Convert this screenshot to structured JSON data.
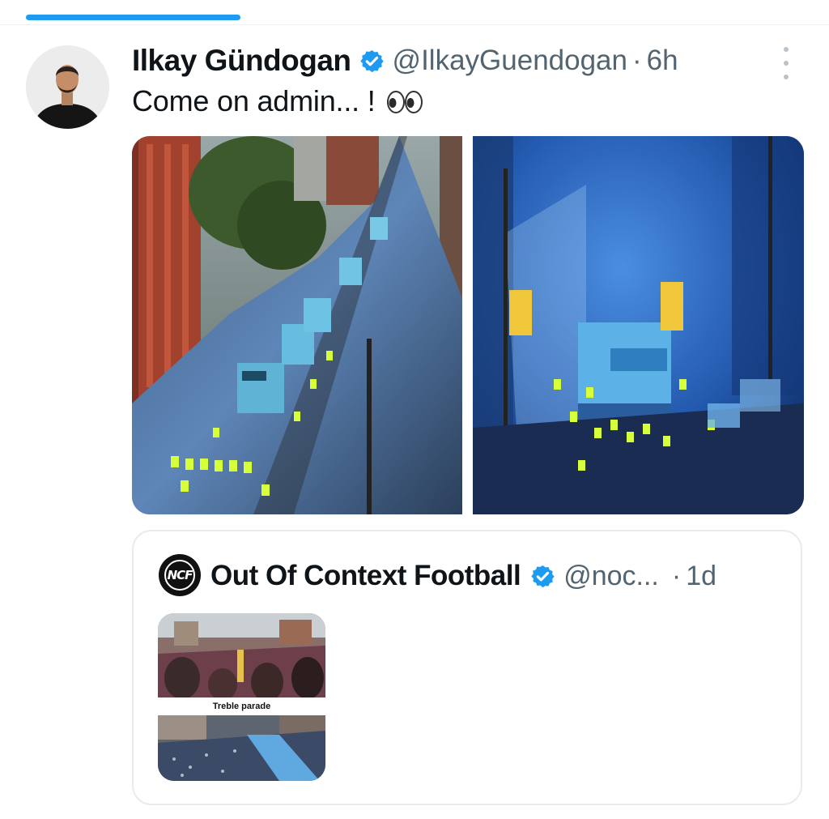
{
  "tweet": {
    "author_name": "Ilkay Gündogan",
    "author_handle": "@IlkayGuendogan",
    "separator": "·",
    "timestamp": "6h",
    "text": "Come on admin... !",
    "verified": true,
    "avatar_icon": "person-avatar",
    "more_icon": "more-vertical-icon",
    "emoji_icon": "eyes-emoji-icon"
  },
  "media": [
    {
      "icon": "parade-photo-bus-street"
    },
    {
      "icon": "parade-photo-bus-crowd-blue"
    }
  ],
  "quoted_tweet": {
    "author_name": "Out Of Context Football",
    "avatar_text": "NCF",
    "author_handle": "@noc...",
    "separator": "·",
    "timestamp": "1d",
    "verified": true,
    "media_caption": "Treble parade"
  },
  "colors": {
    "accent": "#1d9bf0",
    "text_primary": "#0f1419",
    "text_secondary": "#536471",
    "border": "#e6ecf0"
  }
}
